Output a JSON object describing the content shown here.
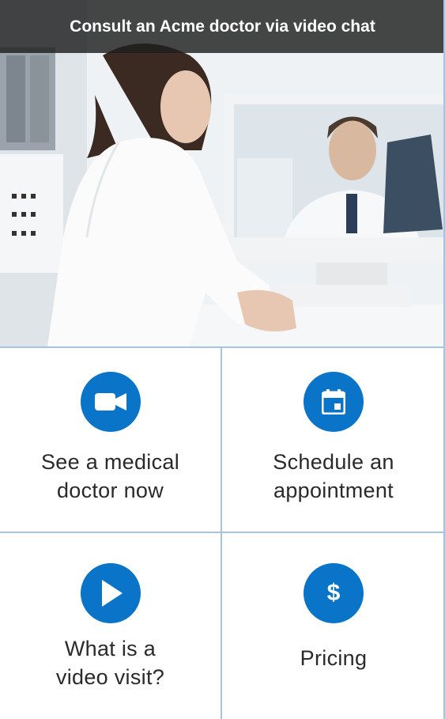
{
  "header": {
    "title": "Consult an Acme doctor via video chat"
  },
  "tiles": [
    {
      "label_line1": "See a medical",
      "label_line2": "doctor now",
      "icon": "video-camera-icon"
    },
    {
      "label_line1": "Schedule an",
      "label_line2": "appointment",
      "icon": "calendar-icon"
    },
    {
      "label_line1": "What is a",
      "label_line2": "video visit?",
      "icon": "play-icon"
    },
    {
      "label_line1": "Pricing",
      "icon": "dollar-icon",
      "symbol": "$"
    }
  ],
  "colors": {
    "accent": "#0a74c9",
    "divider": "#a9c3dc",
    "title_bar": "#1e1e1e"
  }
}
